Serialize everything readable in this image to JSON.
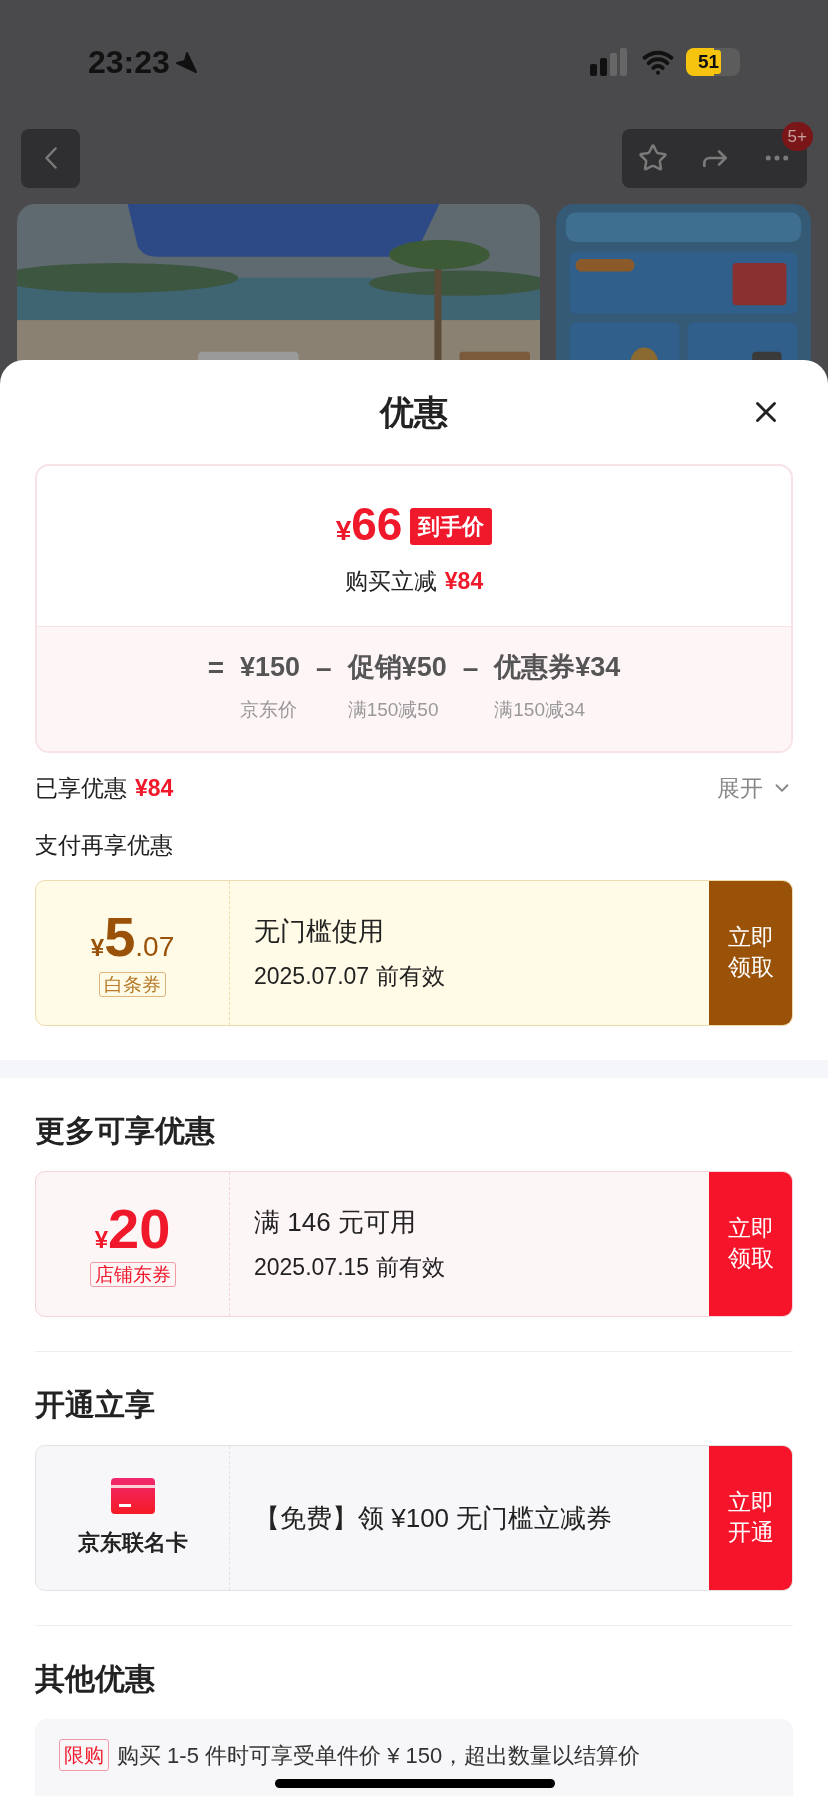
{
  "status_bar": {
    "time": "23:23",
    "battery": "51"
  },
  "nav": {
    "badge": "5+"
  },
  "sheet": {
    "title": "优惠"
  },
  "price_card": {
    "currency": "¥",
    "final_amount": "66",
    "final_tag": "到手价",
    "reduce_label": "购买立减",
    "reduce_amount": "¥84",
    "breakdown": [
      {
        "operator": "=",
        "amount": "¥150",
        "note": "京东价"
      },
      {
        "operator": "–",
        "amount": "促销¥50",
        "note": "满150减50"
      },
      {
        "operator": "–",
        "amount": "优惠券¥34",
        "note": "满150减34"
      }
    ]
  },
  "enjoyed": {
    "label": "已享优惠",
    "amount": "¥84",
    "expand": "展开"
  },
  "sections": [
    {
      "title": "支付再享优惠",
      "small": true,
      "items": [
        {
          "kind": "baitiao",
          "currency": "¥",
          "amount": "5",
          "decimal": ".07",
          "tag": "白条券",
          "condition": "无门槛使用",
          "validity": "2025.07.07 前有效",
          "action": "立即领取"
        }
      ]
    },
    {
      "title": "更多可享优惠",
      "small": false,
      "items": [
        {
          "kind": "store",
          "currency": "¥",
          "amount": "20",
          "tag": "店铺东券",
          "condition": "满 146 元可用",
          "validity": "2025.07.15 前有效",
          "action": "立即领取"
        }
      ]
    },
    {
      "title": "开通立享",
      "small": false,
      "items": [
        {
          "kind": "card",
          "name": "京东联名卡",
          "condition": "【免费】领 ¥100 无门槛立减券",
          "action": "立即开通"
        }
      ]
    }
  ],
  "other": {
    "title": "其他优惠",
    "tag": "限购",
    "text": "购买 1-5 件时可享受单件价 ¥ 150，超出数量以结算价"
  }
}
